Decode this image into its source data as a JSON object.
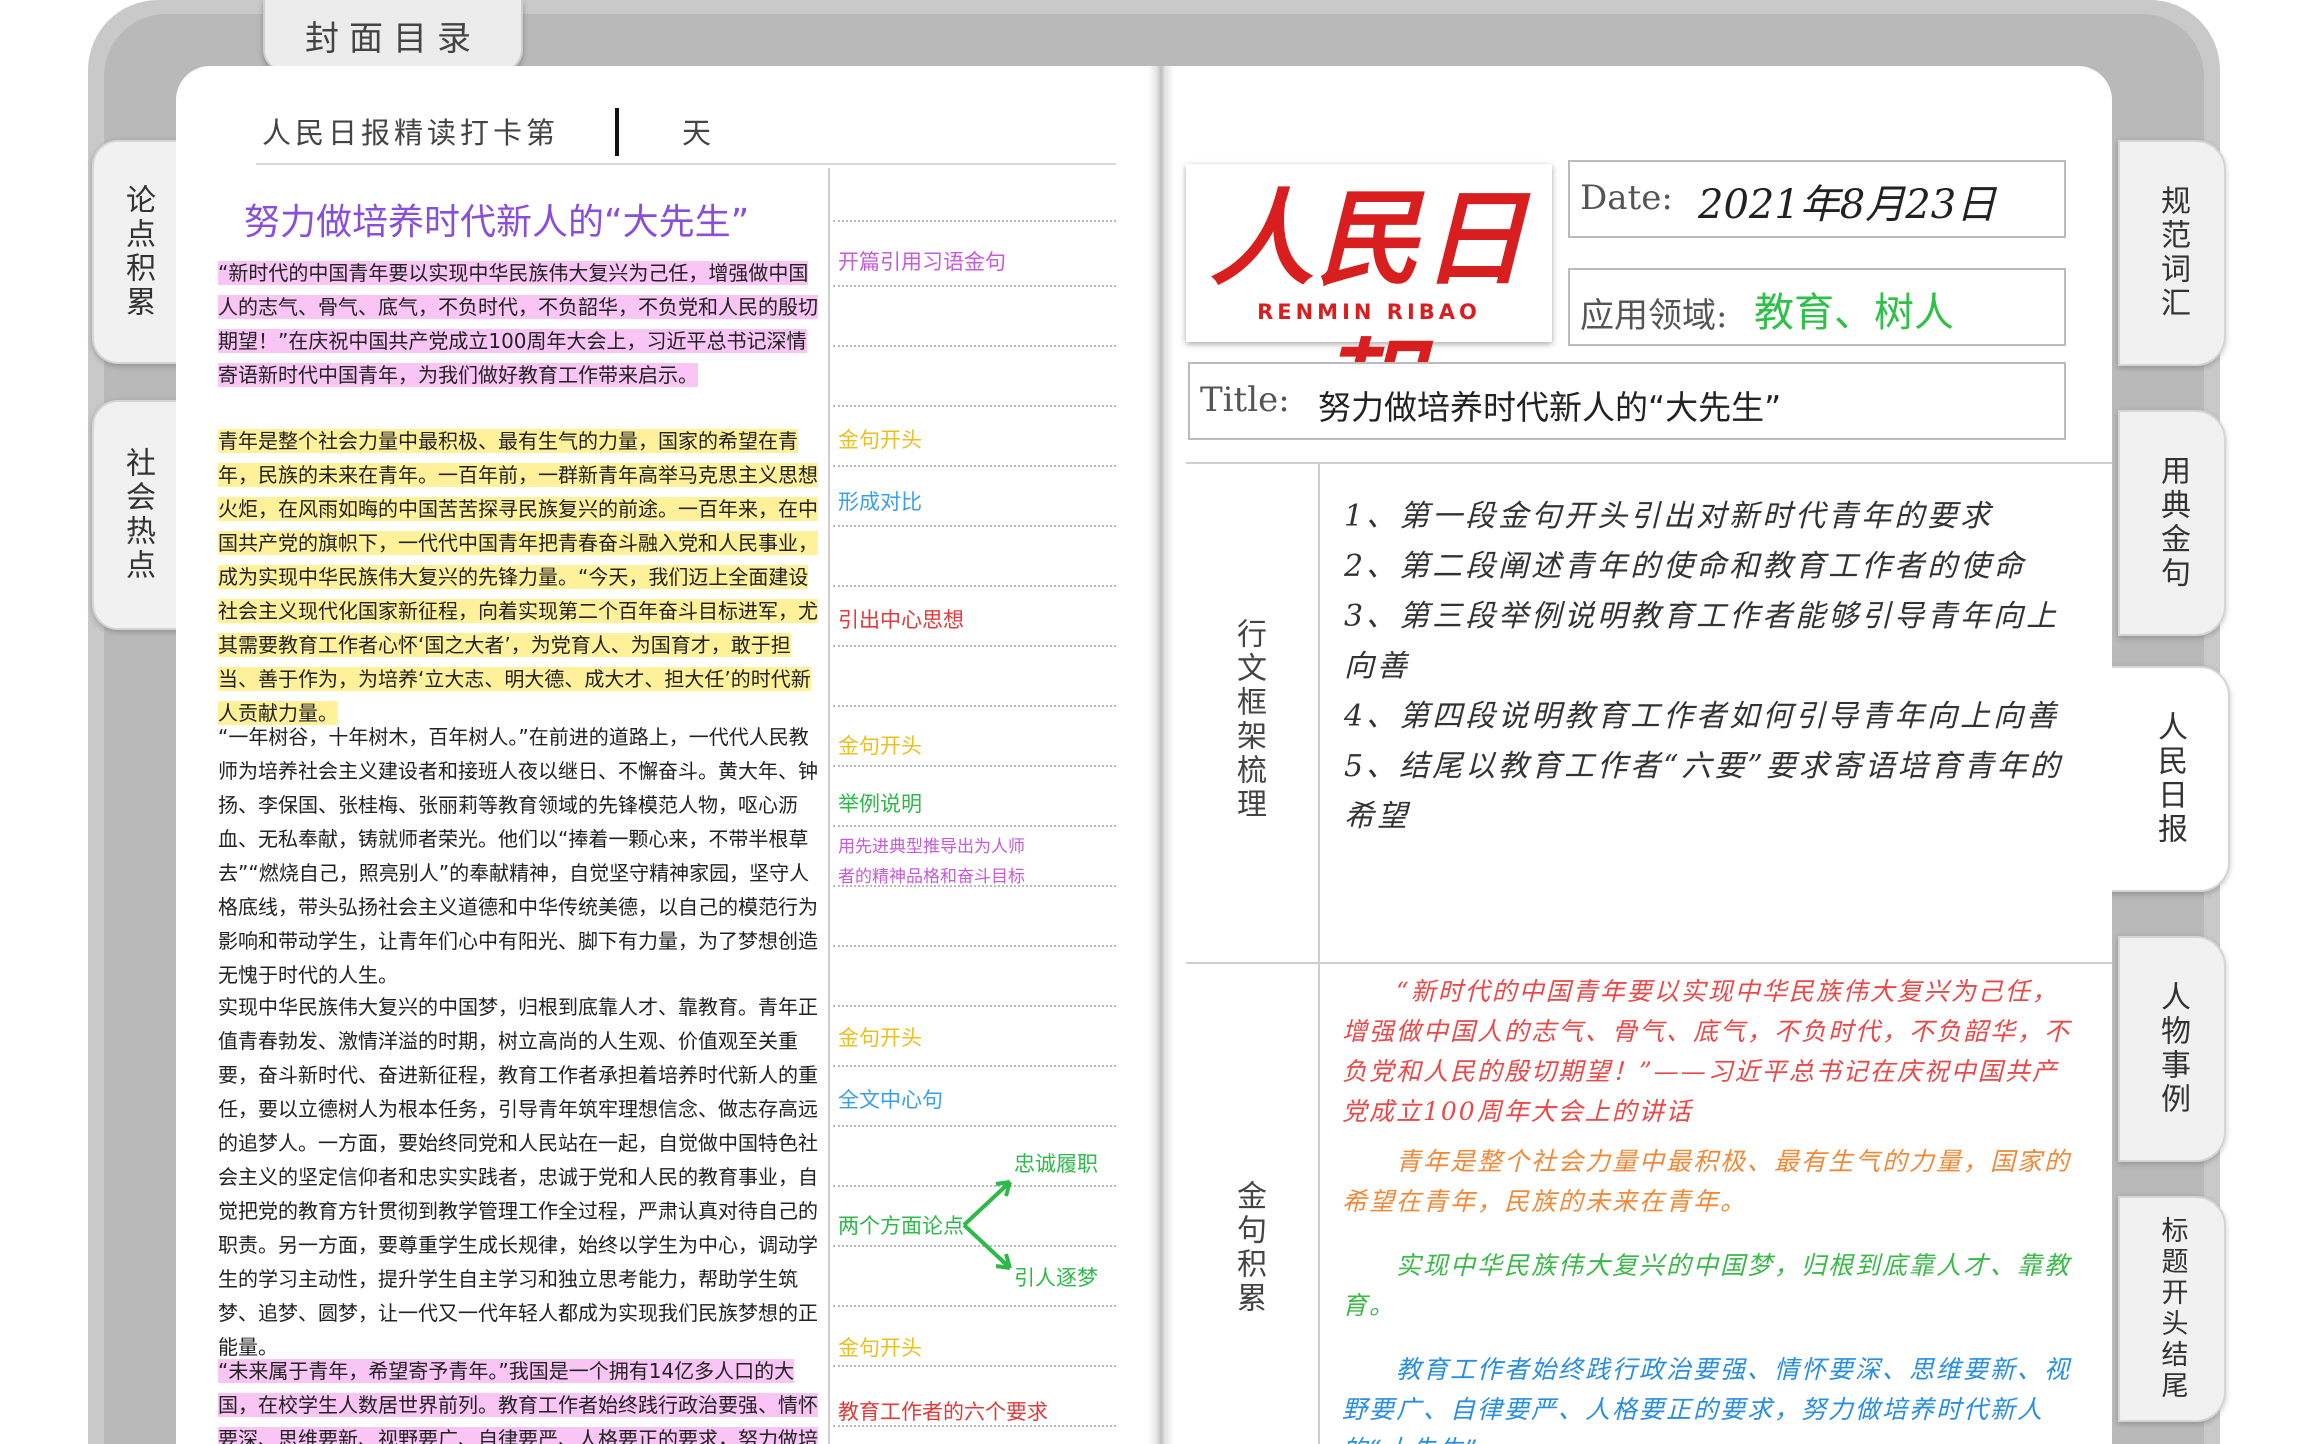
{
  "top_tab": {
    "label": "封面目录"
  },
  "left_tabs": [
    "论点积累",
    "社会热点"
  ],
  "right_tabs": [
    {
      "label": "规范词汇",
      "active": false
    },
    {
      "label": "用典金句",
      "active": false
    },
    {
      "label": "人民日报",
      "active": true
    },
    {
      "label": "人物事例",
      "active": false
    },
    {
      "label": "标题开头结尾",
      "active": false
    }
  ],
  "header": {
    "text": "人民日报精读打卡第",
    "suffix": "天"
  },
  "article": {
    "title": "努力做培养时代新人的“大先生”",
    "paragraphs": [
      "“新时代的中国青年要以实现中华民族伟大复兴为己任，增强做中国人的志气、骨气、底气，不负时代，不负韶华，不负党和人民的殷切期望！”在庆祝中国共产党成立100周年大会上，习近平总书记深情寄语新时代中国青年，为我们做好教育工作带来启示。",
      "青年是整个社会力量中最积极、最有生气的力量，国家的希望在青年，民族的未来在青年。一百年前，一群新青年高举马克思主义思想火炬，在风雨如晦的中国苦苦探寻民族复兴的前途。一百年来，在中国共产党的旗帜下，一代代中国青年把青春奋斗融入党和人民事业，成为实现中华民族伟大复兴的先锋力量。“今天，我们迈上全面建设社会主义现代化国家新征程，向着实现第二个百年奋斗目标进军，尤其需要教育工作者心怀‘国之大者’，为党育人、为国育才，敢于担当、善于作为，为培养‘立大志、明大德、成大才、担大任’的时代新人贡献力量。",
      "“一年树谷，十年树木，百年树人。”在前进的道路上，一代代人民教师为培养社会主义建设者和接班人夜以继日、不懈奋斗。黄大年、钟扬、李保国、张桂梅、张丽莉等教育领域的先锋模范人物，呕心沥血、无私奉献，铸就师者荣光。他们以“捧着一颗心来，不带半根草去”“燃烧自己，照亮别人”的奉献精神，自觉坚守精神家园，坚守人格底线，带头弘扬社会主义道德和中华传统美德，以自己的模范行为影响和带动学生，让青年们心中有阳光、脚下有力量，为了梦想创造无愧于时代的人生。",
      "实现中华民族伟大复兴的中国梦，归根到底靠人才、靠教育。青年正值青春勃发、激情洋溢的时期，树立高尚的人生观、价值观至关重要，奋斗新时代、奋进新征程，教育工作者承担着培养时代新人的重任，要以立德树人为根本任务，引导青年筑牢理想信念、做志存高远的追梦人。一方面，要始终同党和人民站在一起，自觉做中国特色社会主义的坚定信仰者和忠实实践者，忠诚于党和人民的教育事业，自觉把党的教育方针贯彻到教学管理工作全过程，严肃认真对待自己的职责。另一方面，要尊重学生成长规律，始终以学生为中心，调动学生的学习主动性，提升学生自主学习和独立思考能力，帮助学生筑梦、追梦、圆梦，让一代又一代年轻人都成为实现我们民族梦想的正能量。",
      "“未来属于青年，希望寄予青年。”我国是一个拥有14亿多人口的大国，在校学生人数居世界前列。教育工作者始终践行政治要强、情怀要深、思维要新、视野要广、自律要严、人格要正的要求，努力做培养时代新人的“大先"
    ]
  },
  "margin_notes": [
    "开篇引用习语金句",
    "金句开头",
    "形成对比",
    "引出中心思想",
    "金句开头",
    "举例说明",
    "用先进典型推导出为人师",
    "者的精神品格和奋斗目标",
    "金句开头",
    "全文中心句",
    "忠诚履职",
    "两个方面论点",
    "引人逐梦",
    "金句开头",
    "教育工作者的六个要求"
  ],
  "right_page": {
    "logo": {
      "main": "人民日報",
      "sub": "RENMIN RIBAO"
    },
    "date": {
      "label": "Date:",
      "value": "2021年8月23日"
    },
    "field": {
      "label": "应用领域:",
      "value": "教育、树人"
    },
    "title": {
      "label": "Title:",
      "value": "努力做培养时代新人的“大先生”"
    },
    "framework_label": "行文框架梳理",
    "framework_items": [
      "1、第一段金句开头引出对新时代青年的要求",
      "2、第二段阐述青年的使命和教育工作者的使命",
      "3、第三段举例说明教育工作者能够引导青年向上向善",
      "4、第四段说明教育工作者如何引导青年向上向善",
      "5、结尾以教育工作者“六要”要求寄语培育青年的希望"
    ],
    "quotes_label": "金句积累",
    "quotes": [
      {
        "text": "“新时代的中国青年要以实现中华民族伟大复兴为己任，增强做中国人的志气、骨气、底气，不负时代，不负韶华，不负党和人民的殷切期望！”——习近平总书记在庆祝中国共产党成立100周年大会上的讲话",
        "color": "#e84a4a"
      },
      {
        "text": "青年是整个社会力量中最积极、最有生气的力量，国家的希望在青年，民族的未来在青年。",
        "color": "#f08a3a"
      },
      {
        "text": "实现中华民族伟大复兴的中国梦，归根到底靠人才、靠教育。",
        "color": "#3cb84a"
      },
      {
        "text": "教育工作者始终践行政治要强、情怀要深、思维要新、视野要广、自律要严、人格要正的要求，努力做培养时代新人的“大先生”",
        "color": "#2a8ee0"
      }
    ]
  },
  "colors": {
    "note_purple": "#c45bd8",
    "note_yellow": "#e8c020",
    "note_blue": "#3a9ee8",
    "note_red": "#e03a3a",
    "note_green": "#2fb84a"
  }
}
